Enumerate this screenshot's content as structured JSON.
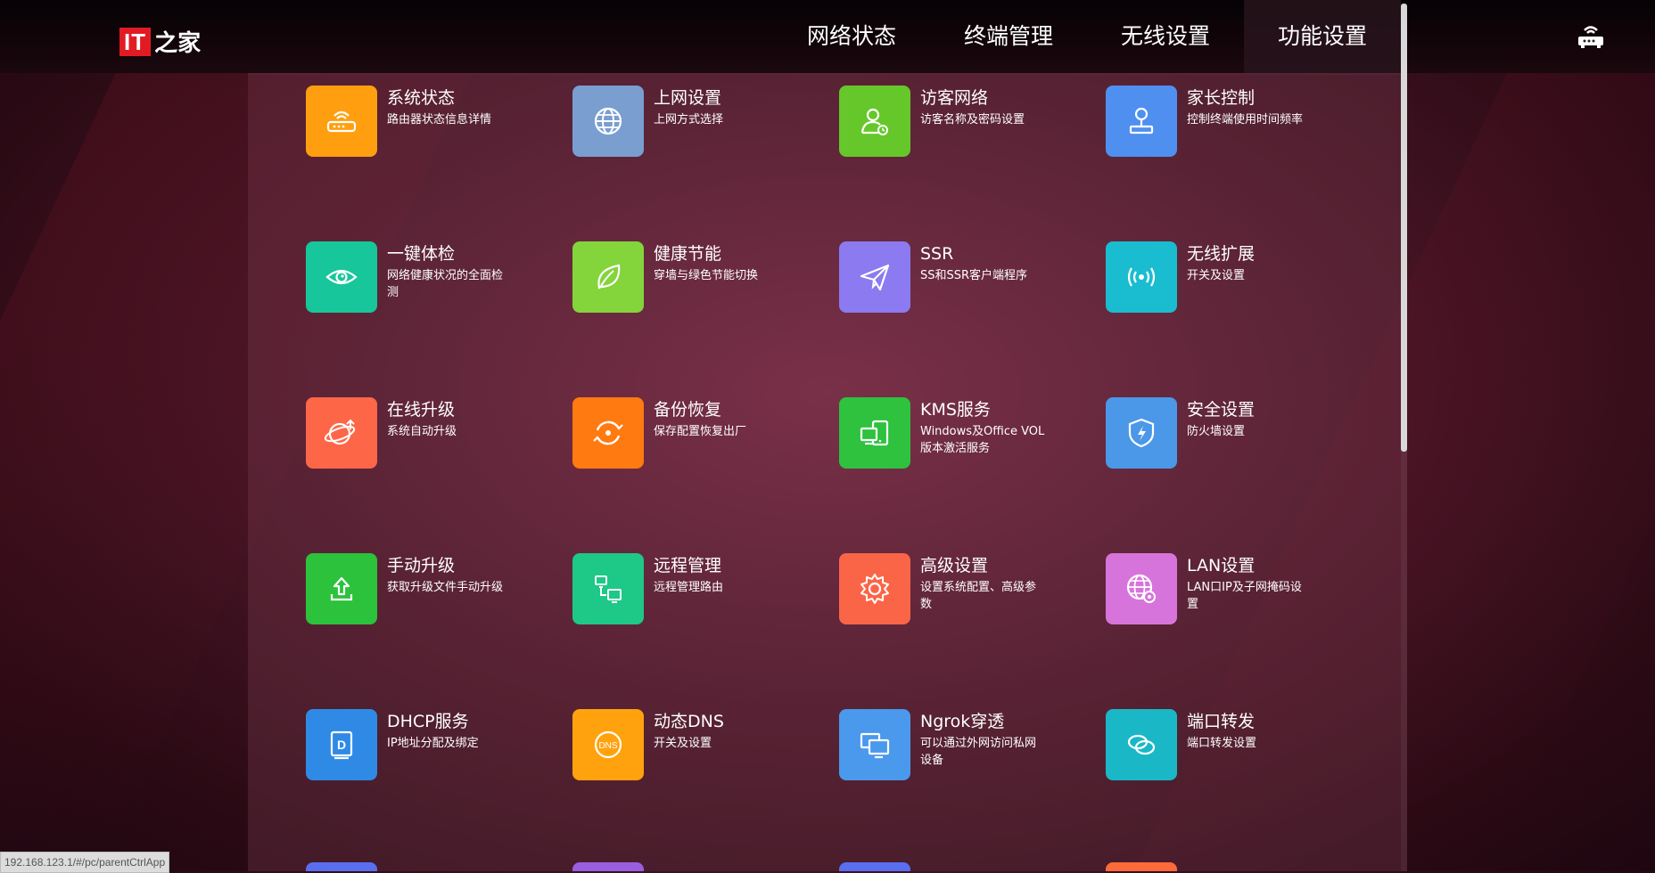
{
  "logo": {
    "mark": "IT",
    "text": "之家"
  },
  "nav": [
    {
      "label": "网络状态"
    },
    {
      "label": "终端管理"
    },
    {
      "label": "无线设置"
    },
    {
      "label": "功能设置",
      "active": true
    }
  ],
  "tiles": [
    {
      "title": "系统状态",
      "desc": "路由器状态信息详情",
      "color": "#ff9f0f",
      "icon": "router-icon"
    },
    {
      "title": "上网设置",
      "desc": "上网方式选择",
      "color": "#7a9ecf",
      "icon": "globe-icon"
    },
    {
      "title": "访客网络",
      "desc": "访客名称及密码设置",
      "color": "#66c72a",
      "icon": "guest-user-icon"
    },
    {
      "title": "家长控制",
      "desc": "控制终端使用时间频率",
      "color": "#4f8ff0",
      "icon": "parent-control-icon"
    },
    {
      "title": "一键体检",
      "desc": "网络健康状况的全面检测",
      "color": "#17c69a",
      "icon": "eye-icon"
    },
    {
      "title": "健康节能",
      "desc": "穿墙与绿色节能切换",
      "color": "#84d43b",
      "icon": "leaf-icon"
    },
    {
      "title": "SSR",
      "desc": "SS和SSR客户端程序",
      "color": "#8b7af0",
      "icon": "paper-plane-icon"
    },
    {
      "title": "无线扩展",
      "desc": "开关及设置",
      "color": "#1abcd0",
      "icon": "wireless-signal-icon"
    },
    {
      "title": "在线升级",
      "desc": "系统自动升级",
      "color": "#fe6648",
      "icon": "online-upgrade-icon"
    },
    {
      "title": "备份恢复",
      "desc": "保存配置恢复出厂",
      "color": "#ff7a11",
      "icon": "backup-restore-icon"
    },
    {
      "title": "KMS服务",
      "desc": "Windows及Office VOL版本激活服务",
      "color": "#2ec23e",
      "icon": "devices-icon"
    },
    {
      "title": "安全设置",
      "desc": "防火墙设置",
      "color": "#4b97e8",
      "icon": "shield-icon"
    },
    {
      "title": "手动升级",
      "desc": "获取升级文件手动升级",
      "color": "#2cc23c",
      "icon": "upload-icon"
    },
    {
      "title": "远程管理",
      "desc": "远程管理路由",
      "color": "#1ec886",
      "icon": "remote-manage-icon"
    },
    {
      "title": "高级设置",
      "desc": "设置系统配置、高级参数",
      "color": "#fb6547",
      "icon": "gear-icon"
    },
    {
      "title": "LAN设置",
      "desc": "LAN口IP及子网掩码设置",
      "color": "#d774db",
      "icon": "lan-globe-icon"
    },
    {
      "title": "DHCP服务",
      "desc": "IP地址分配及绑定",
      "color": "#2f8ae6",
      "icon": "dhcp-icon"
    },
    {
      "title": "动态DNS",
      "desc": "开关及设置",
      "color": "#ffa20e",
      "icon": "dns-icon"
    },
    {
      "title": "Ngrok穿透",
      "desc": "可以通过外网访问私网设备",
      "color": "#4a99ec",
      "icon": "monitors-icon"
    },
    {
      "title": "端口转发",
      "desc": "端口转发设置",
      "color": "#1ab8c6",
      "icon": "port-forward-icon"
    }
  ],
  "peek_colors": [
    "#5a6ef0",
    "#9a5ee0",
    "#5a6ef0",
    "#ff6a3a"
  ],
  "status_url": "192.168.123.1/#/pc/parentCtrlApp"
}
